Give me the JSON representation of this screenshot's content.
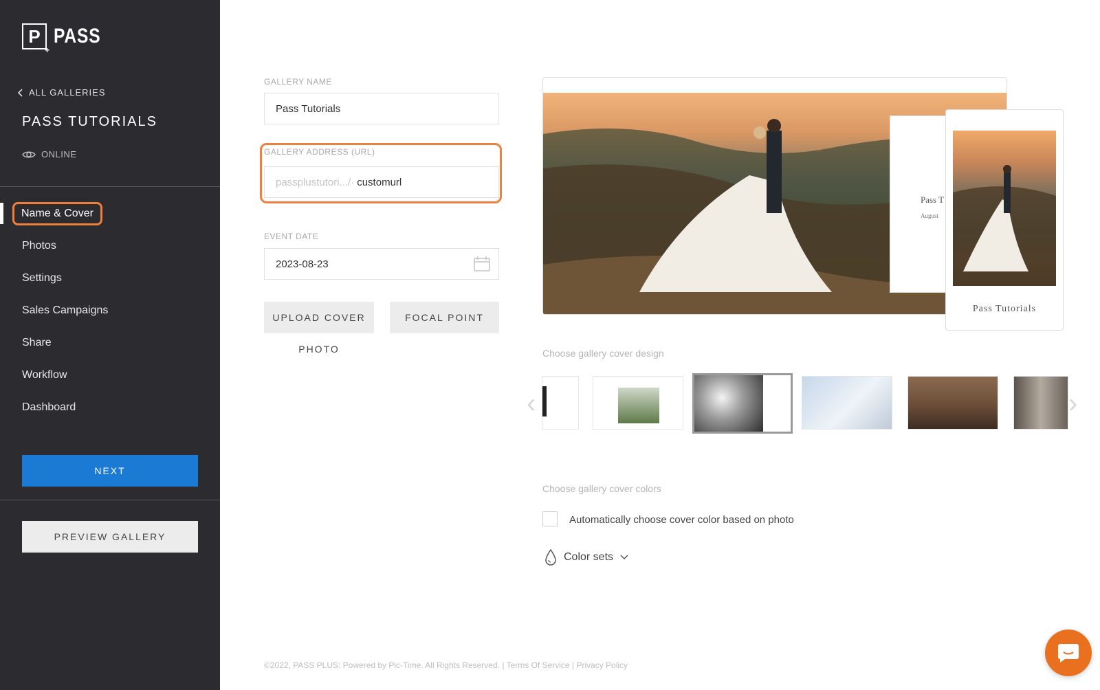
{
  "brand": {
    "logo_letter": "P",
    "logo_text": "PASS"
  },
  "sidebar": {
    "back_label": "ALL GALLERIES",
    "gallery_title": "PASS TUTORIALS",
    "status": "ONLINE",
    "items": [
      {
        "label": "Name & Cover",
        "active": true
      },
      {
        "label": "Photos"
      },
      {
        "label": "Settings"
      },
      {
        "label": "Sales Campaigns"
      },
      {
        "label": "Share"
      },
      {
        "label": "Workflow"
      },
      {
        "label": "Dashboard"
      }
    ],
    "next_label": "NEXT",
    "preview_label": "PREVIEW GALLERY"
  },
  "form": {
    "gallery_name_label": "GALLERY NAME",
    "gallery_name_value": "Pass Tutorials",
    "url_label": "GALLERY ADDRESS (URL)",
    "url_prefix": "passplustutori.../·",
    "url_value": "customurl",
    "event_date_label": "EVENT DATE",
    "event_date_value": "2023-08-23",
    "upload_cover_label": "UPLOAD COVER",
    "upload_cover_label_2": "PHOTO",
    "focal_point_label": "FOCAL POINT"
  },
  "preview": {
    "tablet_title": "Pass T",
    "tablet_date": "August",
    "phone_title": "Pass Tutorials"
  },
  "design": {
    "section_label": "Choose gallery cover design"
  },
  "colors_section": {
    "section_label": "Choose gallery cover colors",
    "auto_label": "Automatically choose cover color based on photo",
    "color_sets_label": "Color sets"
  },
  "footer": {
    "copyright": "©2022, PASS PLUS: Powered by Pic-Time. All Rights Reserved.",
    "sep1": " | ",
    "terms": "Terms Of Service",
    "sep2": " | ",
    "privacy": "Privacy Policy"
  },
  "colors": {
    "accent": "#f07f3c",
    "primary_button": "#1a7ad4",
    "sidebar_bg": "#2b2b30",
    "chat_button": "#e8701f"
  }
}
